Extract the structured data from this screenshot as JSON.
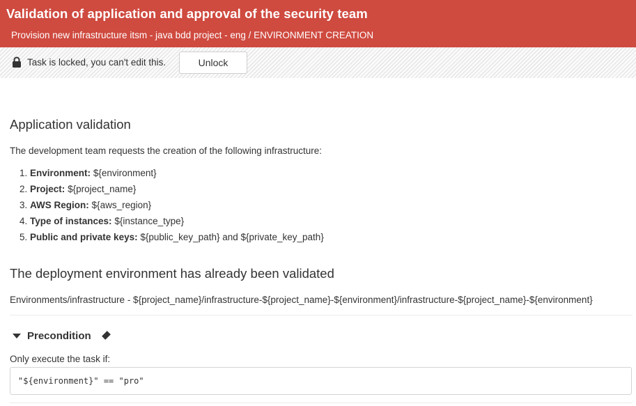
{
  "header": {
    "title": "Validation of application and approval of the security team",
    "subtitle": "Provision new infrastructure itsm - java bdd project - eng / ENVIRONMENT CREATION"
  },
  "lock_bar": {
    "icon": "lock-icon",
    "message": "Task is locked, you can't edit this.",
    "unlock_label": "Unlock"
  },
  "application": {
    "heading": "Application validation",
    "intro": "The development team requests the creation of the following infrastructure:",
    "items": [
      {
        "num": "1.",
        "label": "Environment:",
        "value": "${environment}"
      },
      {
        "num": "2.",
        "label": "Project:",
        "value": "${project_name}"
      },
      {
        "num": "3.",
        "label": "AWS Region:",
        "value": "${aws_region}"
      },
      {
        "num": "4.",
        "label": "Type of instances:",
        "value": "${instance_type}"
      },
      {
        "num": "5.",
        "label": "Public and private keys:",
        "value": "${public_key_path} and ${private_key_path}"
      }
    ]
  },
  "deployment": {
    "heading": "The deployment environment has already been validated",
    "path": "Environments/infrastructure - ${project_name}/infrastructure-${project_name}-${environment}/infrastructure-${project_name}-${environment}"
  },
  "precondition": {
    "label": "Precondition",
    "caret_icon": "caret-down-icon",
    "diamond_icon": "diamond-icon",
    "condition_text": "Only execute the task if:",
    "expression": "\"${environment}\" == \"pro\""
  }
}
